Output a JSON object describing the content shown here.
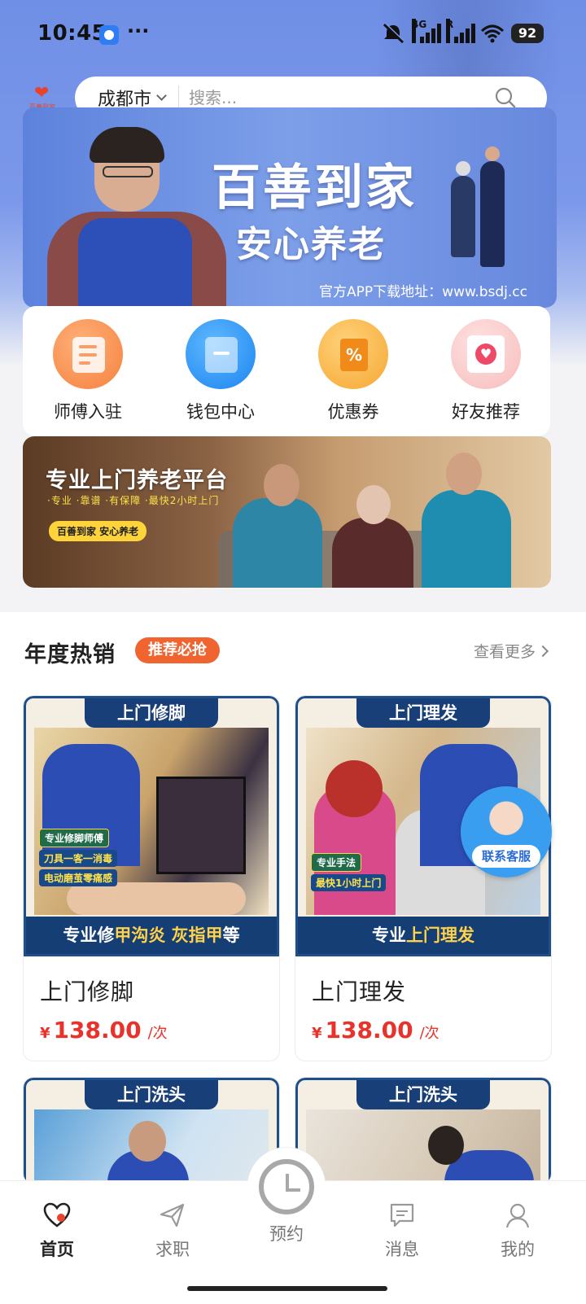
{
  "status_bar": {
    "time": "10:45",
    "more": "···",
    "net_4g": "4G",
    "net_r": "R",
    "battery": "92"
  },
  "header": {
    "logo_text": "百善到家",
    "city": "成都市",
    "search_placeholder": "搜索..."
  },
  "hero": {
    "title": "百善到家",
    "subtitle": "安心养老",
    "url": "官方APP下载地址：www.bsdj.cc"
  },
  "quick_menu": [
    {
      "label": "师傅入驻",
      "icon": "clipboard-icon"
    },
    {
      "label": "钱包中心",
      "icon": "wallet-icon"
    },
    {
      "label": "优惠券",
      "icon": "coupon-icon"
    },
    {
      "label": "好友推荐",
      "icon": "heart-card-icon"
    }
  ],
  "promo": {
    "title": "专业上门养老平台",
    "tags": "·专业  ·靠谱  ·有保障  ·最快2小时上门",
    "badge": "百善到家 安心养老"
  },
  "section": {
    "title": "年度热销",
    "tag": "推荐必抢",
    "more": "查看更多"
  },
  "products": [
    {
      "ribbon": "上门修脚",
      "tags": [
        "专业修脚师傅",
        "刀具一客一消毒",
        "电动磨茧零痛感"
      ],
      "band_prefix": "专业修",
      "band_highlight": "甲沟炎 灰指甲",
      "band_suffix": "等",
      "name": "上门修脚",
      "currency": "¥",
      "price": "138.00",
      "unit": "/次"
    },
    {
      "ribbon": "上门理发",
      "tags": [
        "专业手法",
        "最快1小时上门"
      ],
      "band_prefix": "专业",
      "band_highlight": "上门理发",
      "band_suffix": "",
      "name": "上门理发",
      "currency": "¥",
      "price": "138.00",
      "unit": "/次"
    },
    {
      "ribbon": "上门洗头"
    },
    {
      "ribbon": "上门洗头"
    }
  ],
  "customer_service": "联系客服",
  "bottom_nav": [
    {
      "label": "首页",
      "icon": "home-heart-icon",
      "active": true
    },
    {
      "label": "求职",
      "icon": "paper-plane-icon",
      "active": false
    },
    {
      "label": "预约",
      "icon": "clock-icon",
      "active": false
    },
    {
      "label": "消息",
      "icon": "message-icon",
      "active": false
    },
    {
      "label": "我的",
      "icon": "user-icon",
      "active": false
    }
  ],
  "colors": {
    "brand_blue": "#6f8fe6",
    "accent_orange": "#f0642f",
    "price_red": "#e8322a",
    "card_navy": "#153e74"
  }
}
